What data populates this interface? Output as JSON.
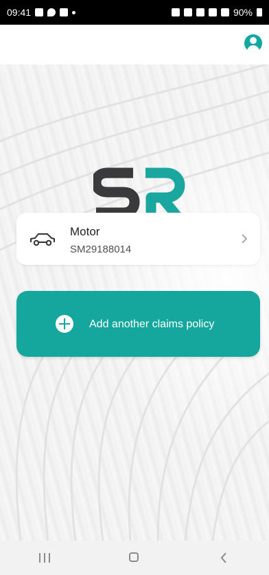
{
  "status_bar": {
    "time": "09:41",
    "battery": "90%"
  },
  "header": {
    "profile_icon": "account-circle-icon"
  },
  "colors": {
    "accent": "#15a79e",
    "logo_dark": "#3a3a3c",
    "logo_teal": "#1aa79f"
  },
  "policy_card": {
    "title": "Motor",
    "policy_number": "SM29188014",
    "icon": "car-icon"
  },
  "add_policy": {
    "label": "Add another claims policy",
    "icon": "plus-circle-icon"
  },
  "nav": {
    "recents": "recents-icon",
    "home": "home-icon",
    "back": "back-icon"
  }
}
